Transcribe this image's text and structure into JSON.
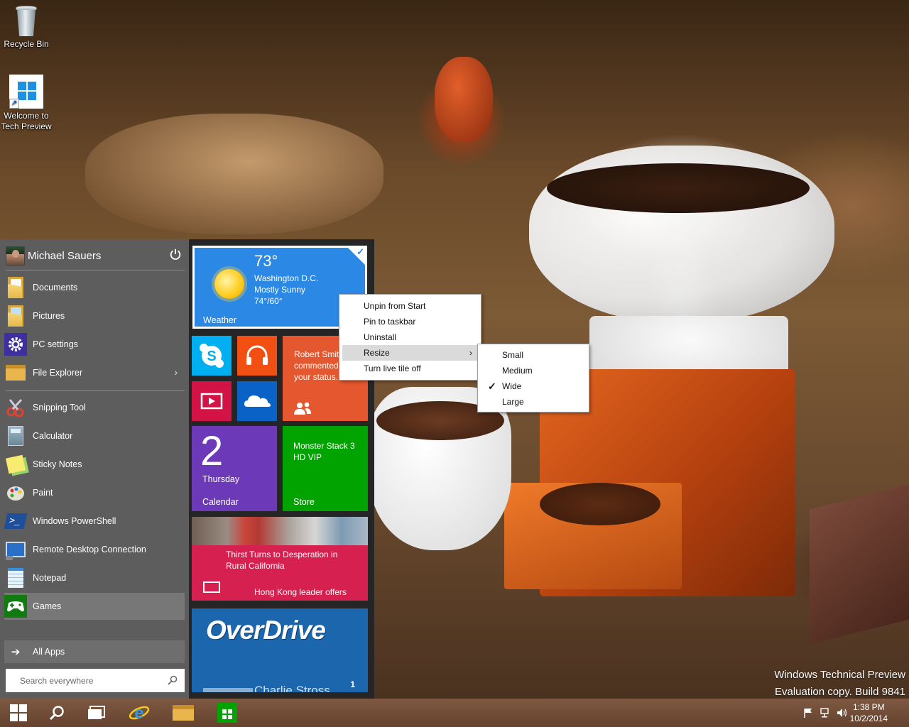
{
  "desktop": {
    "icons": [
      {
        "label": "Recycle Bin",
        "icon": "recycle-bin-icon"
      },
      {
        "label_line1": "Welcome to",
        "label_line2": "Tech Preview",
        "icon": "windows-logo-icon"
      }
    ],
    "watermark": {
      "line1": "Windows Technical Preview",
      "line2": "Evaluation copy. Build 9841"
    }
  },
  "start_menu": {
    "user_name": "Michael Sauers",
    "places": [
      {
        "label": "Documents",
        "icon": "documents-folder-icon"
      },
      {
        "label": "Pictures",
        "icon": "pictures-folder-icon"
      },
      {
        "label": "PC settings",
        "icon": "gear-icon"
      },
      {
        "label": "File Explorer",
        "icon": "file-explorer-icon",
        "has_submenu": true
      }
    ],
    "apps": [
      {
        "label": "Snipping Tool",
        "icon": "snipping-tool-icon"
      },
      {
        "label": "Calculator",
        "icon": "calculator-icon"
      },
      {
        "label": "Sticky Notes",
        "icon": "sticky-notes-icon"
      },
      {
        "label": "Paint",
        "icon": "paint-palette-icon"
      },
      {
        "label": "Windows PowerShell",
        "icon": "powershell-icon"
      },
      {
        "label": "Remote Desktop Connection",
        "icon": "remote-desktop-icon"
      },
      {
        "label": "Notepad",
        "icon": "notepad-icon"
      },
      {
        "label": "Games",
        "icon": "games-controller-icon",
        "selected": true
      }
    ],
    "all_apps_label": "All Apps",
    "search_placeholder": "Search everywhere",
    "tiles": {
      "weather": {
        "temperature": "73°",
        "city": "Washington D.C.",
        "condition": "Mostly Sunny",
        "range": "74°/60°",
        "name": "Weather",
        "selected": true
      },
      "people": {
        "line1": "Robert Smit",
        "line2": "commented",
        "line3": "your status."
      },
      "calendar": {
        "day": "2",
        "weekday": "Thursday",
        "name": "Calendar"
      },
      "store": {
        "line1": "Monster Stack 3",
        "line2": "HD VIP",
        "name": "Store"
      },
      "news": {
        "headline1_line1": "Thirst Turns to Desperation in",
        "headline1_line2": "Rural California",
        "headline2": "Hong Kong leader offers"
      },
      "overdrive": {
        "logo": "OverDrive",
        "badge": "1",
        "partial_text": "Charlie Stross"
      }
    }
  },
  "context_menu": {
    "items": [
      {
        "label": "Unpin from Start"
      },
      {
        "label": "Pin to taskbar"
      },
      {
        "label": "Uninstall"
      },
      {
        "label": "Resize",
        "has_submenu": true,
        "highlighted": true
      },
      {
        "label": "Turn live tile off"
      }
    ],
    "resize_submenu": [
      {
        "label": "Small",
        "checked": false
      },
      {
        "label": "Medium",
        "checked": false
      },
      {
        "label": "Wide",
        "checked": true
      },
      {
        "label": "Large",
        "checked": false
      }
    ]
  },
  "taskbar": {
    "buttons": [
      "start-button",
      "search-button",
      "task-view-button",
      "internet-explorer-button",
      "file-explorer-button",
      "store-button"
    ],
    "time": "1:38 PM",
    "date": "10/2/2014"
  },
  "colors": {
    "start_left": "#5d5d5d",
    "start_right": "#252525",
    "weather_tile": "#2b88e4",
    "skype_tile": "#00aff0",
    "music_tile": "#f24f12",
    "video_tile": "#d31245",
    "onedrive_tile": "#0a62c7",
    "people_tile": "#e5572f",
    "calendar_tile": "#6c3ab8",
    "store_tile": "#00a300",
    "news_tile": "#d6204f",
    "overdrive_tile": "#1c66ad"
  }
}
